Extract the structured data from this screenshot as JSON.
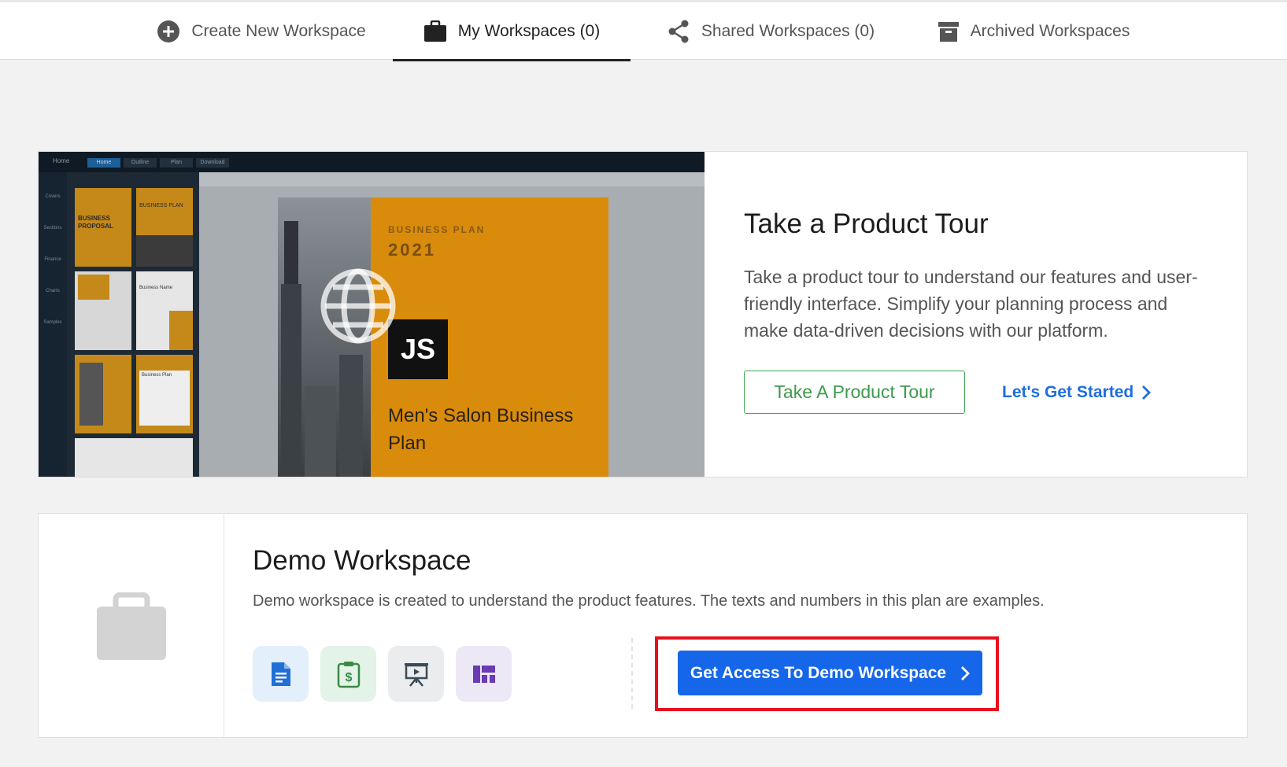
{
  "tabs": [
    {
      "label": "Create New Workspace",
      "icon": "plus-circle-icon",
      "active": false
    },
    {
      "label": "My Workspaces (0)",
      "icon": "briefcase-icon",
      "active": true
    },
    {
      "label": "Shared Workspaces (0)",
      "icon": "share-icon",
      "active": false
    },
    {
      "label": "Archived Workspaces",
      "icon": "archive-icon",
      "active": false
    }
  ],
  "tour": {
    "title": "Take a Product Tour",
    "description": "Take a product tour to understand our features and user-friendly interface. Simplify your planning process and make data-driven decisions with our platform.",
    "button_label": "Take A Product Tour",
    "link_label": "Let's Get Started",
    "preview": {
      "tabs": [
        "Home",
        "Outline",
        "Plan",
        "Download"
      ],
      "sidebar": [
        "Covers",
        "Sections",
        "Finance",
        "Charts",
        "Samples"
      ],
      "thumbnails": [
        "BUSINESS PROPOSAL",
        "BUSINESS PLAN",
        "Business Name",
        "Business Plan"
      ],
      "doc_kicker": "BUSINESS PLAN",
      "doc_year": "2021",
      "doc_logo": "JS",
      "doc_title": "Men's Salon Business Plan"
    }
  },
  "demo": {
    "title": "Demo Workspace",
    "description": "Demo workspace is created to understand the product features. The texts and numbers in this plan are examples.",
    "features": [
      {
        "icon": "document-icon",
        "bg": "#e3effb",
        "color": "#1f6fd6"
      },
      {
        "icon": "financial-clipboard-icon",
        "bg": "#e3f3e7",
        "color": "#3a8a47"
      },
      {
        "icon": "presentation-icon",
        "bg": "#eaecee",
        "color": "#3a4b59"
      },
      {
        "icon": "dashboard-icon",
        "bg": "#ede8f6",
        "color": "#6a3bb5"
      }
    ],
    "cta_label": "Get Access To Demo Workspace"
  },
  "colors": {
    "accent": "#1566e8",
    "green": "#3c9a4c",
    "highlight": "#e8101c",
    "doc_orange": "#d98b0c"
  }
}
